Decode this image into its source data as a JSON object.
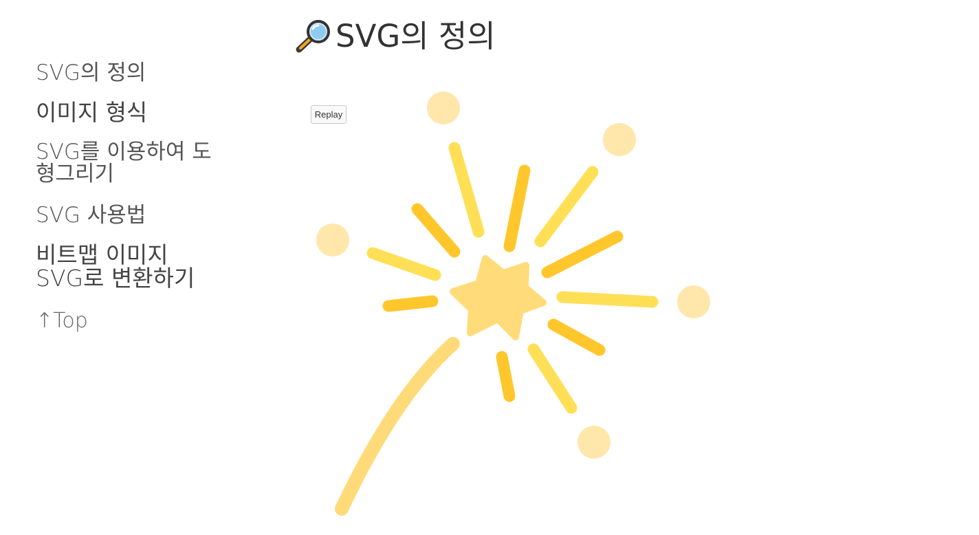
{
  "header": {
    "title": "SVG의 정의",
    "icon": "magnifier-icon"
  },
  "sidebar": {
    "items": [
      {
        "label": "SVG의 정의"
      },
      {
        "label": "이미지 형식"
      },
      {
        "label": "SVG를 이용하여 도형그리기"
      },
      {
        "label": "SVG 사용법"
      },
      {
        "label": "비트맵 이미지 SVG로 변환하기"
      }
    ],
    "top_link": "↑Top"
  },
  "main": {
    "replay_label": "Replay",
    "illustration": "firework-sparkler-icon"
  },
  "colors": {
    "ray_yellow": "#FFDF55",
    "ray_orange": "#FFC72C",
    "star": "#FFDB7A",
    "dot": "#FFE7AC",
    "stem": "#FFDA78"
  }
}
